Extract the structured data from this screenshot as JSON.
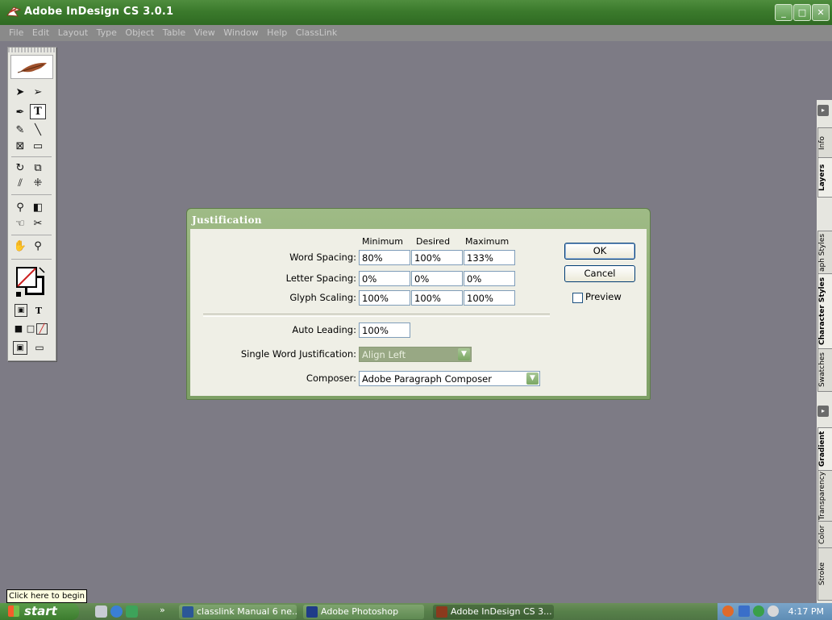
{
  "window": {
    "title": "Adobe InDesign CS 3.0.1",
    "controls": {
      "minimize": "_",
      "maximize": "□",
      "close": "✕"
    }
  },
  "menubar": [
    "File",
    "Edit",
    "Layout",
    "Type",
    "Object",
    "Table",
    "View",
    "Window",
    "Help",
    "ClassLink"
  ],
  "toolbox": {
    "icons": [
      "selection-arrow-icon",
      "direct-selection-icon",
      "pen-icon",
      "type-tool-icon",
      "pencil-icon",
      "line-icon",
      "rectangle-frame-icon",
      "rectangle-icon",
      "rotate-icon",
      "scale-icon",
      "shear-icon",
      "free-transform-icon",
      "eyedropper-icon",
      "gradient-icon",
      "button-icon",
      "scissors-icon",
      "hand-icon",
      "zoom-icon"
    ],
    "formatting_label": "T"
  },
  "right_panel": {
    "group1_tabs": [
      "Info",
      "Layers"
    ],
    "group2_tabs": [
      "Paragraph Styles",
      "Character Styles",
      "Swatches"
    ],
    "group3_tabs": [
      "Gradient",
      "Transparency",
      "Color",
      "Stroke"
    ],
    "group2_first_label": "aph Styles"
  },
  "dialog": {
    "title": "Justification",
    "columns": [
      "Minimum",
      "Desired",
      "Maximum"
    ],
    "rows": [
      {
        "label": "Word Spacing:",
        "min": "80%",
        "desired": "100%",
        "max": "133%"
      },
      {
        "label": "Letter Spacing:",
        "min": "0%",
        "desired": "0%",
        "max": "0%"
      },
      {
        "label": "Glyph Scaling:",
        "min": "100%",
        "desired": "100%",
        "max": "100%"
      }
    ],
    "auto_leading": {
      "label": "Auto Leading:",
      "value": "100%"
    },
    "single_word": {
      "label": "Single Word Justification:",
      "value": "Align Left"
    },
    "composer": {
      "label": "Composer:",
      "value": "Adobe Paragraph Composer"
    },
    "buttons": {
      "ok": "OK",
      "cancel": "Cancel"
    },
    "preview": {
      "label": "Preview",
      "checked": false
    }
  },
  "tooltip": "Click here to begin",
  "taskbar": {
    "start_label": "start",
    "overflow": "»",
    "tasks": [
      {
        "label": "classlink Manual 6 ne...",
        "active": false
      },
      {
        "label": "Adobe Photoshop",
        "active": false
      },
      {
        "label": "Adobe InDesign CS 3...",
        "active": true
      }
    ],
    "clock": "4:17 PM"
  },
  "colors": {
    "titlebar": "#3b7a2c",
    "dialog_frame": "#8fae78",
    "workspace": "#7d7b85",
    "stroke_swatch": "#cc2222"
  }
}
